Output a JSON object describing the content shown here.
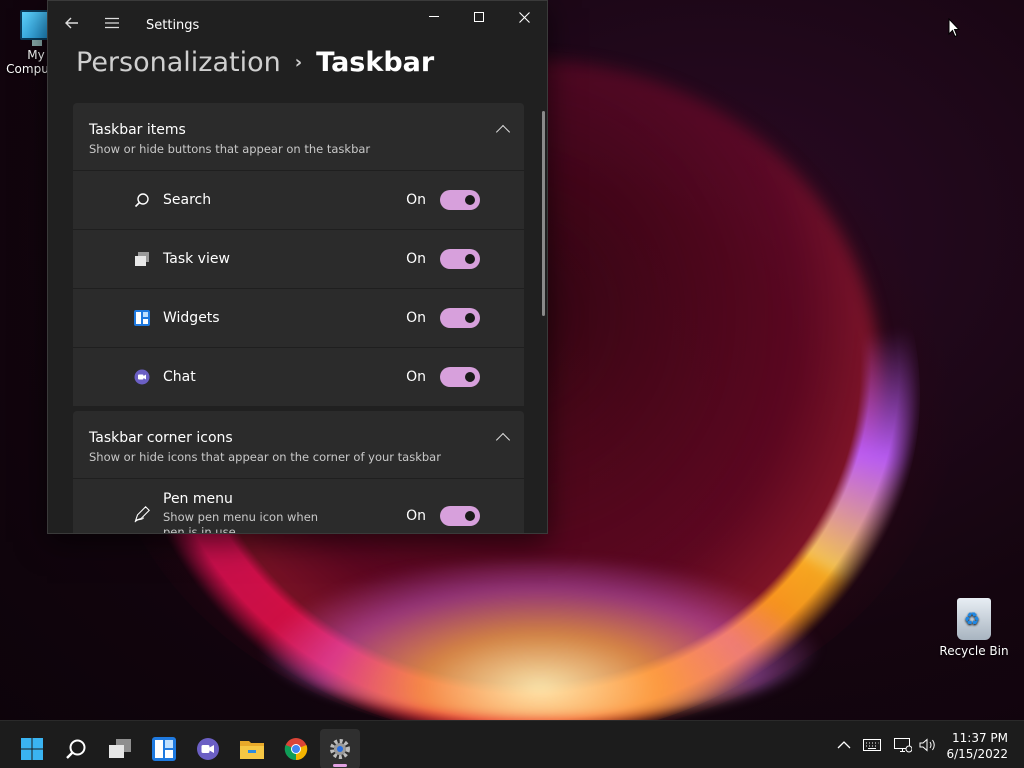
{
  "desktop": {
    "icons": [
      {
        "label": "My Computer",
        "icon": "computer-icon"
      },
      {
        "label": "Recycle Bin",
        "icon": "recycle-bin-icon"
      }
    ]
  },
  "window": {
    "app_title": "Settings",
    "nav": {
      "back_icon": "back-arrow-icon",
      "menu_icon": "hamburger-menu-icon"
    },
    "controls": {
      "minimize": "minimize-icon",
      "maximize": "maximize-icon",
      "close": "close-icon"
    },
    "breadcrumb": {
      "parent": "Personalization",
      "separator": "›",
      "current": "Taskbar"
    },
    "sections": [
      {
        "title": "Taskbar items",
        "subtitle": "Show or hide buttons that appear on the taskbar",
        "items": [
          {
            "label": "Search",
            "state": "On",
            "icon": "search-icon",
            "toggle_on": true
          },
          {
            "label": "Task view",
            "state": "On",
            "icon": "task-view-icon",
            "toggle_on": true
          },
          {
            "label": "Widgets",
            "state": "On",
            "icon": "widgets-icon",
            "toggle_on": true
          },
          {
            "label": "Chat",
            "state": "On",
            "icon": "chat-icon",
            "toggle_on": true
          }
        ]
      },
      {
        "title": "Taskbar corner icons",
        "subtitle": "Show or hide icons that appear on the corner of your taskbar",
        "items": [
          {
            "label": "Pen menu",
            "description": "Show pen menu icon when pen is in use",
            "state": "On",
            "icon": "pen-icon",
            "toggle_on": true
          }
        ]
      }
    ]
  },
  "taskbar": {
    "apps": [
      {
        "name": "start",
        "icon": "windows-start-icon"
      },
      {
        "name": "search",
        "icon": "search-icon"
      },
      {
        "name": "task-view",
        "icon": "task-view-icon"
      },
      {
        "name": "widgets",
        "icon": "widgets-icon"
      },
      {
        "name": "chat",
        "icon": "chat-icon"
      },
      {
        "name": "file-explorer",
        "icon": "folder-icon"
      },
      {
        "name": "chrome",
        "icon": "chrome-icon"
      },
      {
        "name": "settings",
        "icon": "gear-icon",
        "active": true
      }
    ],
    "tray": [
      "chevron-up-icon",
      "keyboard-icon",
      "network-icon",
      "volume-icon"
    ],
    "clock": {
      "time": "11:37 PM",
      "date": "6/15/2022"
    }
  },
  "colors": {
    "accent": "#d7a0dc",
    "window_bg": "#202020",
    "card_bg": "#2b2b2b"
  }
}
